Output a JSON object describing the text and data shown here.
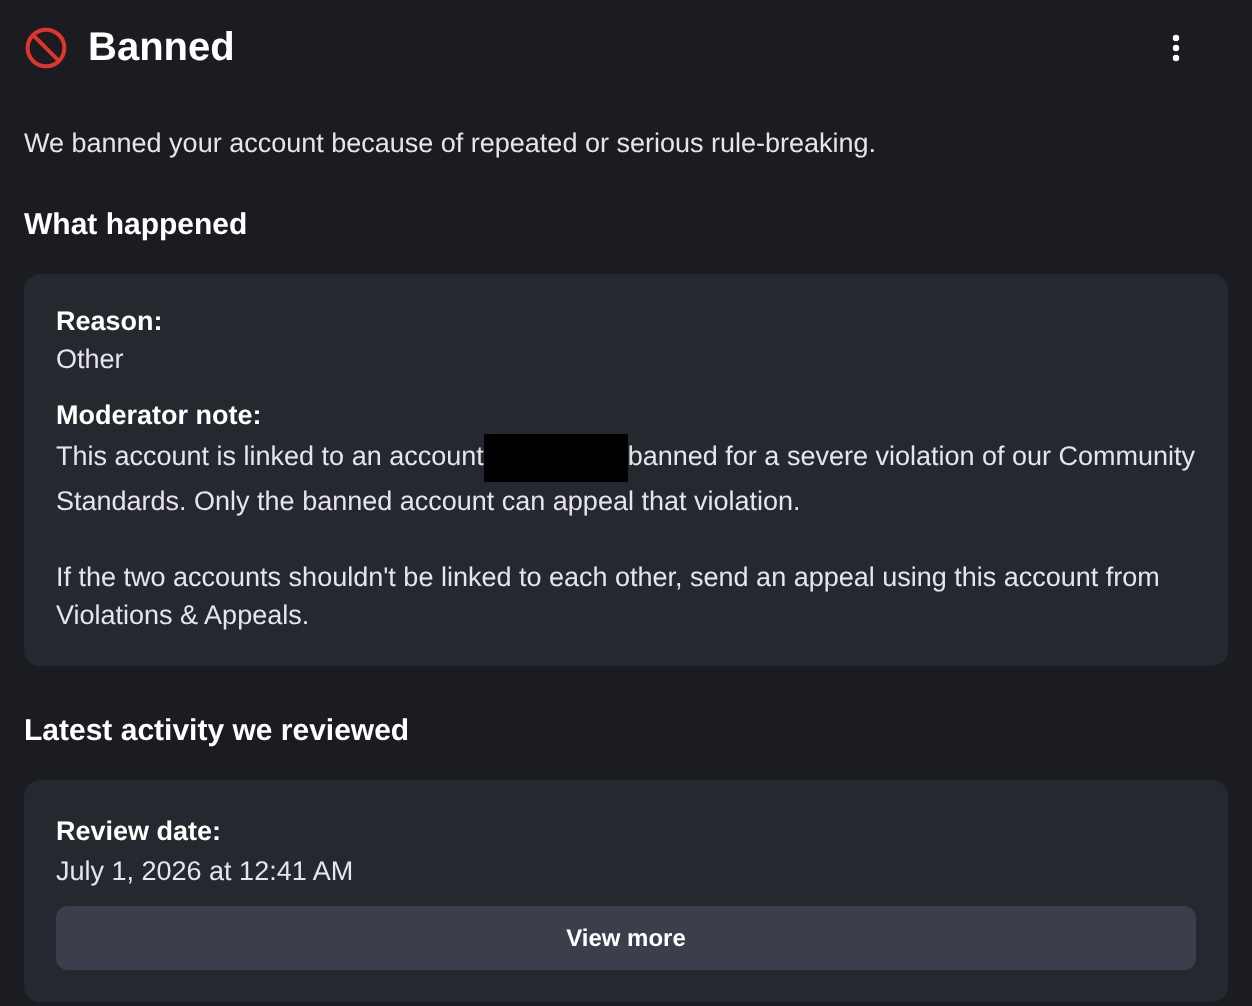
{
  "header": {
    "title": "Banned"
  },
  "intro": "We banned your account because of repeated or serious rule-breaking.",
  "what_happened": {
    "heading": "What happened",
    "reason_label": "Reason:",
    "reason": "Other",
    "note_label": "Moderator note:",
    "note_before": "This account is linked to an account",
    "note_redacted": true,
    "note_after": "banned for a severe violation of our Community Standards. Only the banned account can appeal that violation.",
    "note_more": "If the two accounts shouldn't be linked to each other, send an appeal using this account from Violations & Appeals."
  },
  "latest_activity": {
    "heading": "Latest activity we reviewed",
    "date_label": "Review date:",
    "date": "July 1, 2026 at 12:41 AM",
    "button": "View more"
  }
}
